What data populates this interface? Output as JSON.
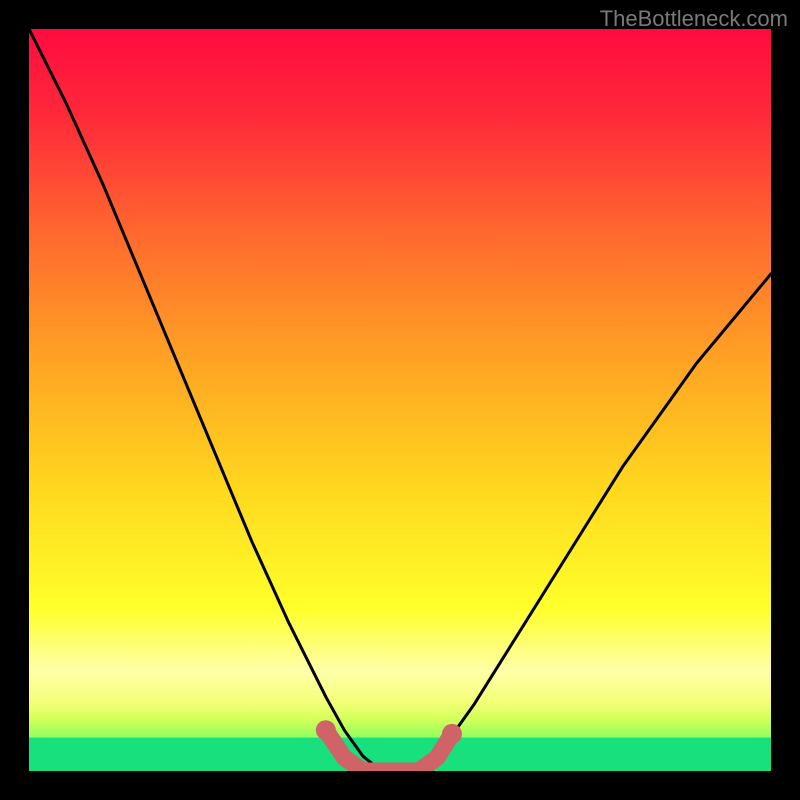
{
  "watermark": "TheBottleneck.com",
  "chart_data": {
    "type": "line",
    "title": "",
    "xlabel": "",
    "ylabel": "",
    "xlim": [
      0,
      1
    ],
    "ylim": [
      0,
      1
    ],
    "series": [
      {
        "name": "curve",
        "x": [
          0.0,
          0.05,
          0.1,
          0.15,
          0.2,
          0.25,
          0.3,
          0.35,
          0.4,
          0.425,
          0.45,
          0.475,
          0.5,
          0.525,
          0.55,
          0.6,
          0.65,
          0.7,
          0.75,
          0.8,
          0.85,
          0.9,
          0.95,
          1.0
        ],
        "y": [
          1.0,
          0.9,
          0.79,
          0.67,
          0.55,
          0.43,
          0.31,
          0.2,
          0.1,
          0.055,
          0.02,
          0.0,
          0.0,
          0.0,
          0.02,
          0.09,
          0.17,
          0.25,
          0.33,
          0.41,
          0.48,
          0.55,
          0.61,
          0.67
        ]
      },
      {
        "name": "highlight-segment",
        "x": [
          0.4,
          0.425,
          0.45,
          0.475,
          0.5,
          0.525,
          0.55,
          0.57
        ],
        "y": [
          0.055,
          0.018,
          0.0,
          0.0,
          0.0,
          0.0,
          0.018,
          0.05
        ]
      }
    ],
    "gradient_bands": [
      {
        "stop": 0.0,
        "color": "#ff0b3f"
      },
      {
        "stop": 0.12,
        "color": "#ff2a3a"
      },
      {
        "stop": 0.28,
        "color": "#ff6a2e"
      },
      {
        "stop": 0.45,
        "color": "#ffa423"
      },
      {
        "stop": 0.62,
        "color": "#ffd81e"
      },
      {
        "stop": 0.78,
        "color": "#ffff2a"
      },
      {
        "stop": 0.865,
        "color": "#feffa8"
      },
      {
        "stop": 0.905,
        "color": "#f6ff7a"
      },
      {
        "stop": 0.93,
        "color": "#d4ff5a"
      },
      {
        "stop": 0.955,
        "color": "#90ff60"
      },
      {
        "stop": 0.978,
        "color": "#34f57e"
      },
      {
        "stop": 1.0,
        "color": "#14e07a"
      }
    ],
    "highlight_color": "#cf6367",
    "curve_color": "#000000",
    "green_band_top_fraction": 0.955
  }
}
